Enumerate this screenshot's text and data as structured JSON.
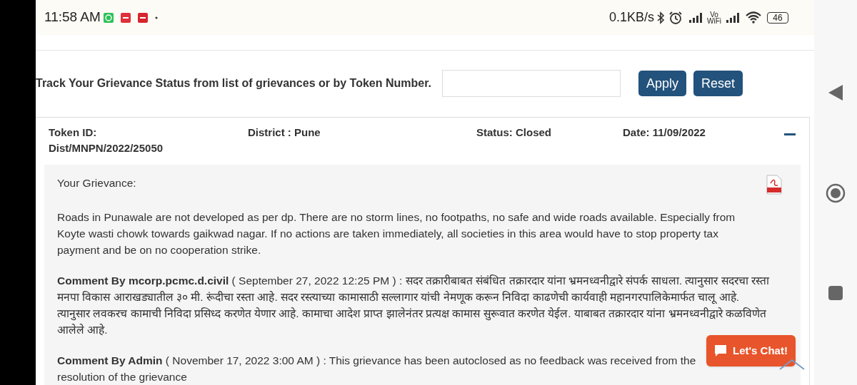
{
  "status_bar": {
    "time": "11:58 AM",
    "speed": "0.1KB/s",
    "vowifi": [
      "Vo",
      "WiFi"
    ],
    "battery": "46"
  },
  "filter": {
    "label": "Track Your Grievance Status from list of grievances or by Token Number.",
    "buttons": [
      "Apply",
      "Reset"
    ]
  },
  "grievance": {
    "expanded": true,
    "fields": [
      {
        "kind": "token",
        "lines": [
          "Token ID:",
          "Dist/MNPN/2022/25050"
        ]
      },
      {
        "kind": "district",
        "lines": [
          "District : Pune"
        ]
      },
      {
        "kind": "status",
        "lines": [
          "Status: Closed"
        ]
      },
      {
        "kind": "date",
        "lines": [
          "Date: 11/09/2022"
        ]
      }
    ],
    "heading": "Your Grievance:",
    "text": "Roads in Punawale are not developed as per dp. There are no storm lines, no footpaths, no safe and wide roads available. Especially from Koyte wasti chowk towards gaikwad nagar. If no actions are taken immediately, all societies in this area would have to stop property tax payment and be on no cooperation strike.",
    "comments": [
      {
        "lines": [
          "**Comment By mcorp.pcmc.d.civil** ( September 27, 2022 12:25 PM ) : सदर तक्रारीबाबत संबंधित तक्रारदार यांना भ्रमनध्वनीद्वारे संपर्क साधला. त्यानुसार सदरचा रस्ता मनपा विकास आराखड्यातील ३० मी. रूंदीचा रस्ता आहे. सदर रस्त्याच्या कामासाठी सल्लागार यांची नेमणूक करून निविदा काढणेची कार्यवाही महानगरपालिकेमार्फत चालू आहे. त्यानुसार लवकरच कामाची निविदा प्रसिध्द करणेत येणार आहे. कामाचा आदेश प्राप्त झालेनंतर प्रत्यक्ष कामास सुरूवात करणेत येईल. याबाबत तक्रारदार यांना भ्रमनध्वनीद्वारे कळविणेत आलेले आहे."
        ]
      },
      {
        "lines": [
          "**Comment By Admin** ( November 17, 2022 3:00 AM ) : This grievance has been autoclosed as no feedback was received from the",
          "resolution of the grievance"
        ]
      }
    ]
  },
  "chat_button": "Let's Chat!"
}
